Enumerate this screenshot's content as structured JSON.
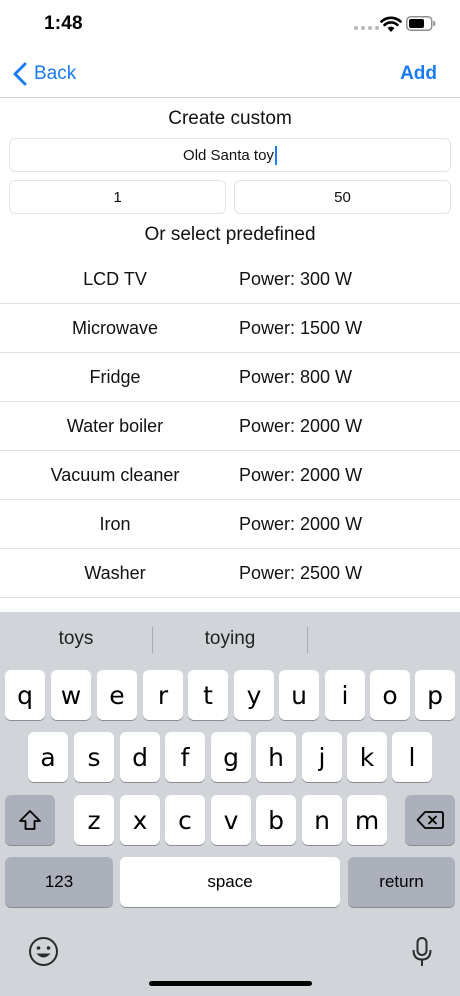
{
  "status_bar": {
    "time": "1:48"
  },
  "nav": {
    "back_label": "Back",
    "add_label": "Add"
  },
  "custom": {
    "title": "Create custom",
    "name_value": "Old Santa toy",
    "quantity_value": "1",
    "power_value": "50"
  },
  "predefined": {
    "title": "Or select predefined",
    "devices": [
      {
        "name": "LCD TV",
        "power": "Power: 300 W"
      },
      {
        "name": "Microwave",
        "power": "Power: 1500 W"
      },
      {
        "name": "Fridge",
        "power": "Power: 800 W"
      },
      {
        "name": "Water boiler",
        "power": "Power: 2000 W"
      },
      {
        "name": "Vacuum cleaner",
        "power": "Power: 2000 W"
      },
      {
        "name": "Iron",
        "power": "Power: 2000 W"
      },
      {
        "name": "Washer",
        "power": "Power: 2500 W"
      }
    ]
  },
  "keyboard": {
    "suggestions": [
      "toys",
      "toying",
      ""
    ],
    "row1": [
      "q",
      "w",
      "e",
      "r",
      "t",
      "y",
      "u",
      "i",
      "o",
      "p"
    ],
    "row2": [
      "a",
      "s",
      "d",
      "f",
      "g",
      "h",
      "j",
      "k",
      "l"
    ],
    "row3": [
      "z",
      "x",
      "c",
      "v",
      "b",
      "n",
      "m"
    ],
    "numbers_label": "123",
    "space_label": "space",
    "return_label": "return"
  },
  "colors": {
    "accent": "#1a7cf5",
    "keyboard_bg": "#d1d4d9",
    "key_dark": "#abb0ba"
  }
}
